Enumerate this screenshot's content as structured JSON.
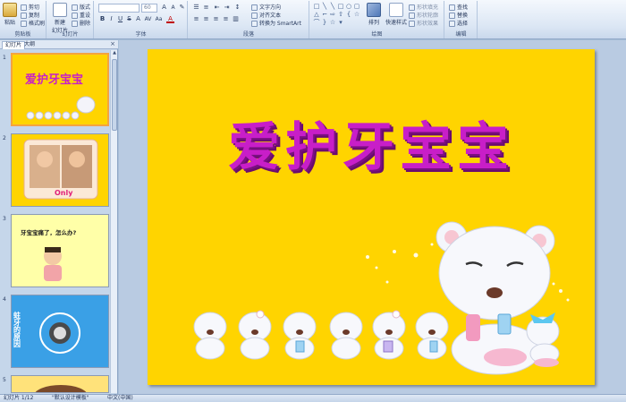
{
  "ribbon": {
    "clipboard": {
      "paste": "粘贴",
      "cut": "剪切",
      "copy": "复制",
      "format_painter": "格式刷",
      "label": "剪贴板"
    },
    "slides": {
      "new_slide": "新建\n幻灯片",
      "layout": "版式",
      "reset": "重设",
      "delete": "删除",
      "label": "幻灯片"
    },
    "font": {
      "font_name": "",
      "font_size": "60",
      "label": "字体",
      "bold": "B",
      "italic": "I",
      "underline": "U",
      "strike": "S",
      "shadow": "A",
      "grow": "A",
      "shrink": "A",
      "color": "A",
      "spacing": "AV",
      "case": "Aa"
    },
    "paragraph": {
      "text_direction": "文字方向",
      "align_text": "对齐文本",
      "smartart": "转换为 SmartArt",
      "label": "段落"
    },
    "drawing": {
      "arrange": "排列",
      "quick_styles": "快速样式",
      "shape_fill": "形状填充",
      "shape_outline": "形状轮廓",
      "shape_effects": "形状效果",
      "label": "绘图"
    },
    "editing": {
      "find": "查找",
      "replace": "替换",
      "select": "选择",
      "label": "编辑"
    }
  },
  "panel": {
    "tab_slides": "幻灯片",
    "tab_outline": "大纲",
    "close": "×",
    "slides": [
      {
        "num": "1"
      },
      {
        "num": "2"
      },
      {
        "num": "3",
        "text": "牙宝宝痛了，怎么办?"
      },
      {
        "num": "4",
        "text": "蛀牙的原因"
      },
      {
        "num": "5"
      }
    ]
  },
  "slide": {
    "title": "爱护牙宝宝"
  },
  "status": {
    "slide_count": "幻灯片 1/12",
    "theme": "\"默认设计模板\"",
    "language": "中文(中国)"
  },
  "colors": {
    "slide_bg": "#ffd400",
    "title": "#c81ec8",
    "thumb4_bg": "#3aa0e6"
  }
}
